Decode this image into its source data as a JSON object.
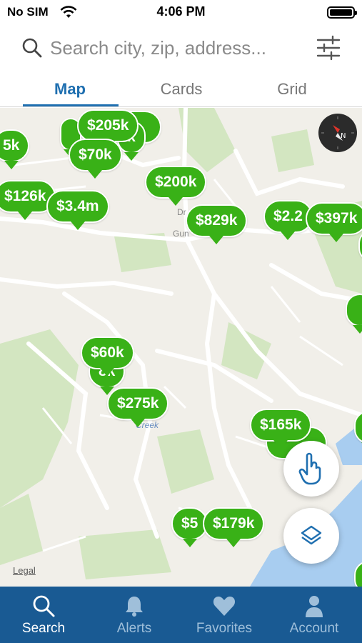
{
  "status_bar": {
    "carrier": "No SIM",
    "time": "4:06 PM"
  },
  "search": {
    "placeholder": "Search city, zip, address..."
  },
  "tabs": [
    {
      "label": "Map",
      "active": true
    },
    {
      "label": "Cards",
      "active": false
    },
    {
      "label": "Grid",
      "active": false
    }
  ],
  "map": {
    "legal_label": "Legal",
    "street_labels": [
      "Gun",
      "Creek",
      "Dr"
    ],
    "pins": [
      "5k",
      "$205k",
      "k",
      "$70k",
      "$200k",
      "$126k",
      "$3.4m",
      "$829k",
      "$2.2",
      "$397k",
      "$60k",
      "8k",
      "$275k",
      "$165k",
      "$5",
      "$179k"
    ]
  },
  "bottom_nav": [
    {
      "label": "Search",
      "icon": "search-icon",
      "active": true
    },
    {
      "label": "Alerts",
      "icon": "bell-icon",
      "active": false
    },
    {
      "label": "Favorites",
      "icon": "heart-icon",
      "active": false
    },
    {
      "label": "Account",
      "icon": "person-icon",
      "active": false
    }
  ],
  "colors": {
    "accent": "#1f6fb0",
    "pin": "#39b117",
    "nav_bg": "#195a93"
  }
}
